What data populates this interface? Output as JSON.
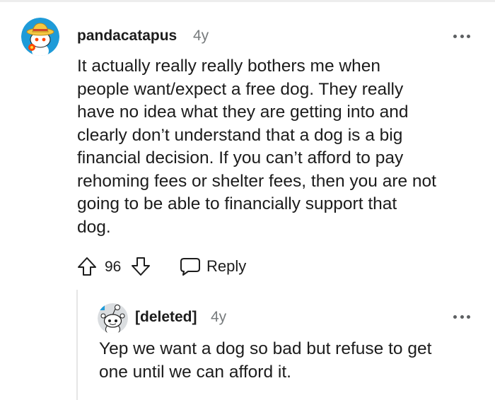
{
  "comment": {
    "username": "pandacatapus",
    "age": "4y",
    "body_lines": [
      "It actually really really bothers me when",
      "people want/expect a free dog. They really",
      "have no idea what they are getting into and",
      "clearly don’t understand that a dog is a big",
      "financial decision. If you can’t afford to pay",
      "rehoming fees or shelter fees, then you are not",
      "going to be able to financially support that",
      "dog."
    ],
    "vote_count": "96",
    "reply_label": "Reply",
    "avatar_icon": "snoo-straw-hat-avatar-icon",
    "more_icon": "more-options-icon"
  },
  "reply_comment": {
    "username": "[deleted]",
    "age": "4y",
    "body_lines": [
      "Yep we want a dog so bad but refuse to get",
      "one until we can afford it."
    ],
    "avatar_icon": "snoo-default-avatar-icon",
    "more_icon": "more-options-icon"
  },
  "colors": {
    "text": "#1c1c1c",
    "meta": "#787c7e",
    "avatar_blue": "#1f9bd8",
    "avatar_bg_gray": "#dadde0",
    "thread_line": "#e6e6e6"
  }
}
